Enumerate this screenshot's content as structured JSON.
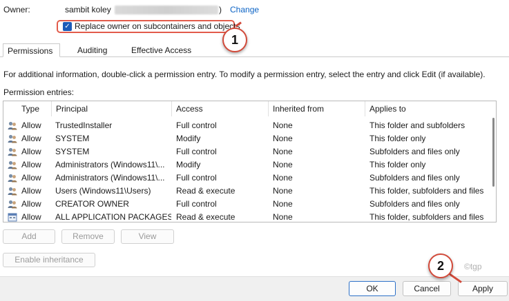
{
  "owner": {
    "label": "Owner:",
    "name": "sambit koley",
    "paren_close": ")",
    "change_link": "Change"
  },
  "replace_owner": {
    "checked": true,
    "label": "Replace owner on subcontainers and objects"
  },
  "callouts": {
    "first": "1",
    "second": "2"
  },
  "tabs": [
    {
      "label": "Permissions"
    },
    {
      "label": "Auditing"
    },
    {
      "label": "Effective Access"
    }
  ],
  "info_text": "For additional information, double-click a permission entry. To modify a permission entry, select the entry and click Edit (if available).",
  "entries_label": "Permission entries:",
  "table": {
    "headers": [
      "Type",
      "Principal",
      "Access",
      "Inherited from",
      "Applies to"
    ],
    "rows": [
      {
        "icon": "users-icon",
        "type": "Allow",
        "principal": "TrustedInstaller",
        "access": "Full control",
        "inherited": "None",
        "applies": "This folder and subfolders"
      },
      {
        "icon": "users-icon",
        "type": "Allow",
        "principal": "SYSTEM",
        "access": "Modify",
        "inherited": "None",
        "applies": "This folder only"
      },
      {
        "icon": "users-icon",
        "type": "Allow",
        "principal": "SYSTEM",
        "access": "Full control",
        "inherited": "None",
        "applies": "Subfolders and files only"
      },
      {
        "icon": "users-icon",
        "type": "Allow",
        "principal": "Administrators (Windows11\\...",
        "access": "Modify",
        "inherited": "None",
        "applies": "This folder only"
      },
      {
        "icon": "users-icon",
        "type": "Allow",
        "principal": "Administrators (Windows11\\...",
        "access": "Full control",
        "inherited": "None",
        "applies": "Subfolders and files only"
      },
      {
        "icon": "users-icon",
        "type": "Allow",
        "principal": "Users (Windows11\\Users)",
        "access": "Read & execute",
        "inherited": "None",
        "applies": "This folder, subfolders and files"
      },
      {
        "icon": "users-icon",
        "type": "Allow",
        "principal": "CREATOR OWNER",
        "access": "Full control",
        "inherited": "None",
        "applies": "Subfolders and files only"
      },
      {
        "icon": "app-packages-icon",
        "type": "Allow",
        "principal": "ALL APPLICATION PACKAGES",
        "access": "Read & execute",
        "inherited": "None",
        "applies": "This folder, subfolders and files"
      }
    ]
  },
  "buttons": {
    "add": "Add",
    "remove": "Remove",
    "view": "View",
    "enable_inheritance": "Enable inheritance",
    "ok": "OK",
    "cancel": "Cancel",
    "apply": "Apply"
  },
  "watermark": "©tgp",
  "colors": {
    "accent": "#1c5bb8",
    "link": "#0b63c5",
    "callout_border": "#d24a3a"
  }
}
